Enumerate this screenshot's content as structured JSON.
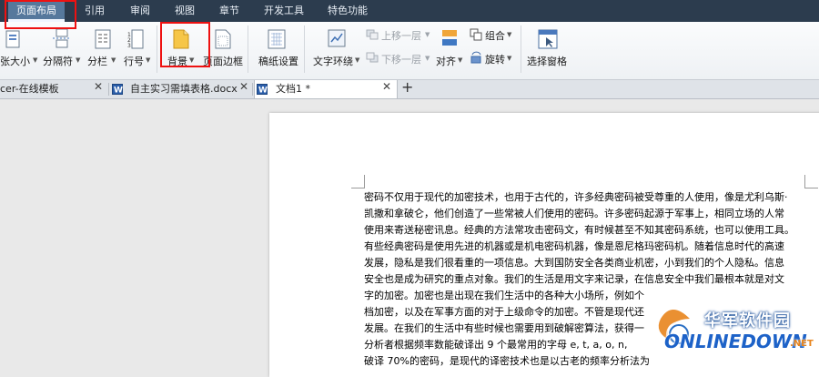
{
  "menu": {
    "items": [
      "页面布局",
      "引用",
      "审阅",
      "视图",
      "章节",
      "开发工具",
      "特色功能"
    ],
    "active_index": 0
  },
  "ribbon": {
    "paper_size": "张大小",
    "separator": "分隔符",
    "columns": "分栏",
    "line_number": "行号",
    "background": "背景",
    "page_border": "页面边框",
    "manuscript": "稿纸设置",
    "text_wrap": "文字环绕",
    "bring_forward": "上移一层",
    "send_backward": "下移一层",
    "align": "对齐",
    "group": "组合",
    "rotate": "旋转",
    "selection_pane": "选择窗格"
  },
  "tabs": [
    {
      "label": "cer-在线模板",
      "active": false
    },
    {
      "label": "自主实习需填表格.docx",
      "active": false
    },
    {
      "label": "文档1 *",
      "active": true
    }
  ],
  "tabs_new": "+",
  "document": {
    "lines": [
      "密码不仅用于现代的加密技术，也用于古代的，许多经典密码被受尊重的人使用，像是尤利乌斯·",
      "凯撒和拿破仑，他们创造了一些常被人们使用的密码。许多密码起源于军事上，相同立场的人常",
      "使用来寄送秘密讯息。经典的方法常攻击密码文，有时候甚至不知其密码系统，也可以使用工具。",
      "有些经典密码是使用先进的机器或是机电密码机器，像是恩尼格玛密码机。随着信息时代的高速",
      "发展，隐私是我们很看重的一项信息。大到国防安全各类商业机密，小到我们的个人隐私。信息",
      "安全也是成为研究的重点对象。我们的生活是用文字来记录，在信息安全中我们最根本就是对文",
      "字的加密。加密也是出现在我们生活中的各种大小场所，例如个",
      "档加密，以及在军事方面的对于上级命令的加密。不管是现代还",
      "发展。在我们的生活中有些时候也需要用到破解密算法，获得一",
      "分析者根据频率数能破译出 9 个最常用的字母 e, t, a, o, n,",
      "破译 70%的密码，是现代的译密技术也是以古老的频率分析法为"
    ]
  },
  "watermark": {
    "cn": "华军软件园",
    "en": "ONLINEDOWN",
    "suffix": ".NET"
  }
}
